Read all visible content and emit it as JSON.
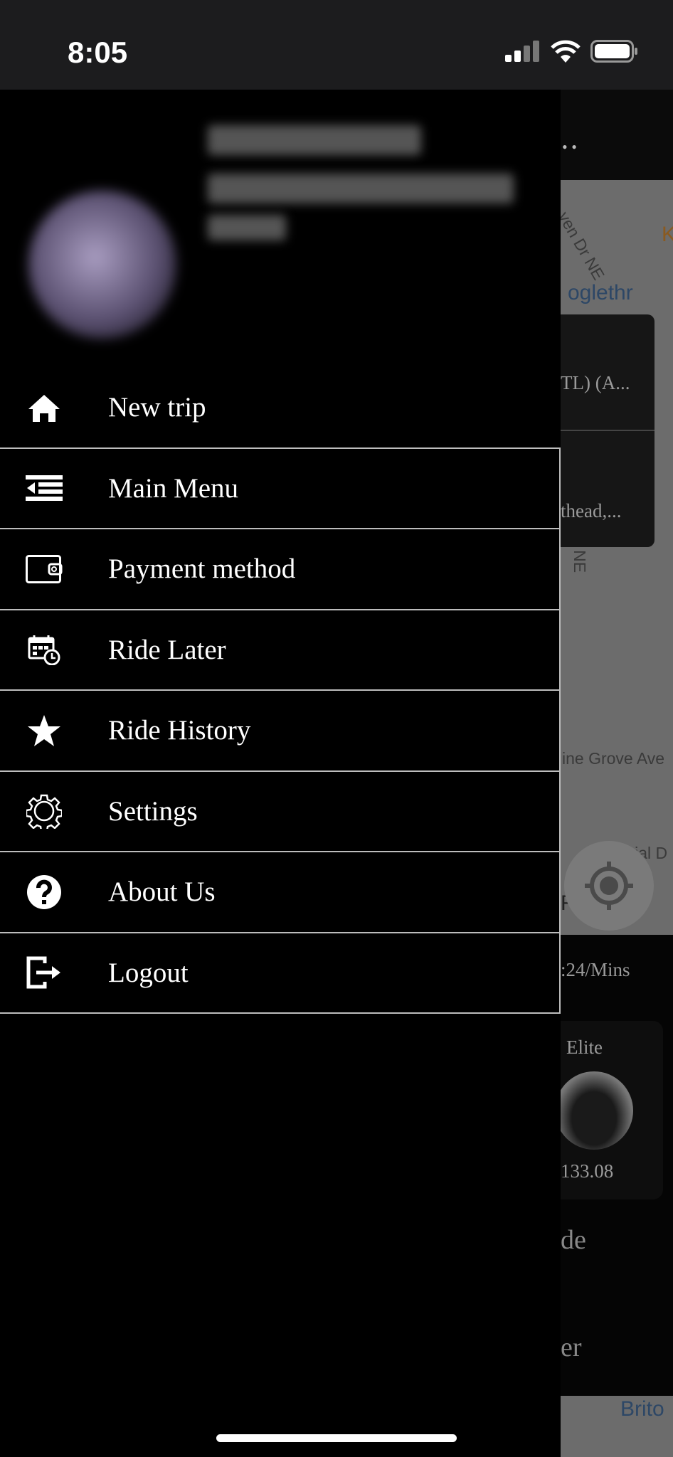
{
  "status_bar": {
    "time": "8:05"
  },
  "drawer": {
    "menu": [
      {
        "label": "New trip",
        "icon": "home-icon"
      },
      {
        "label": "Main Menu",
        "icon": "menu-list-icon"
      },
      {
        "label": "Payment method",
        "icon": "wallet-icon"
      },
      {
        "label": "Ride Later",
        "icon": "calendar-clock-icon"
      },
      {
        "label": "Ride History",
        "icon": "star-icon"
      },
      {
        "label": "Settings",
        "icon": "gear-icon"
      },
      {
        "label": "About Us",
        "icon": "question-circle-icon"
      },
      {
        "label": "Logout",
        "icon": "logout-icon"
      }
    ]
  },
  "background": {
    "pickup_text": "TL) (A...",
    "dropoff_text": "thead,...",
    "map_labels": [
      "ven Dr NE",
      "K",
      "Colonial Dr NE",
      "ine Grove Ave",
      "Colonial D",
      "RK",
      "Brito",
      "oglethr"
    ],
    "rate_text": ":24/Mins",
    "vehicle": {
      "name": "Elite",
      "price": "133.08"
    },
    "button1_text": "de",
    "button2_text": "er"
  }
}
